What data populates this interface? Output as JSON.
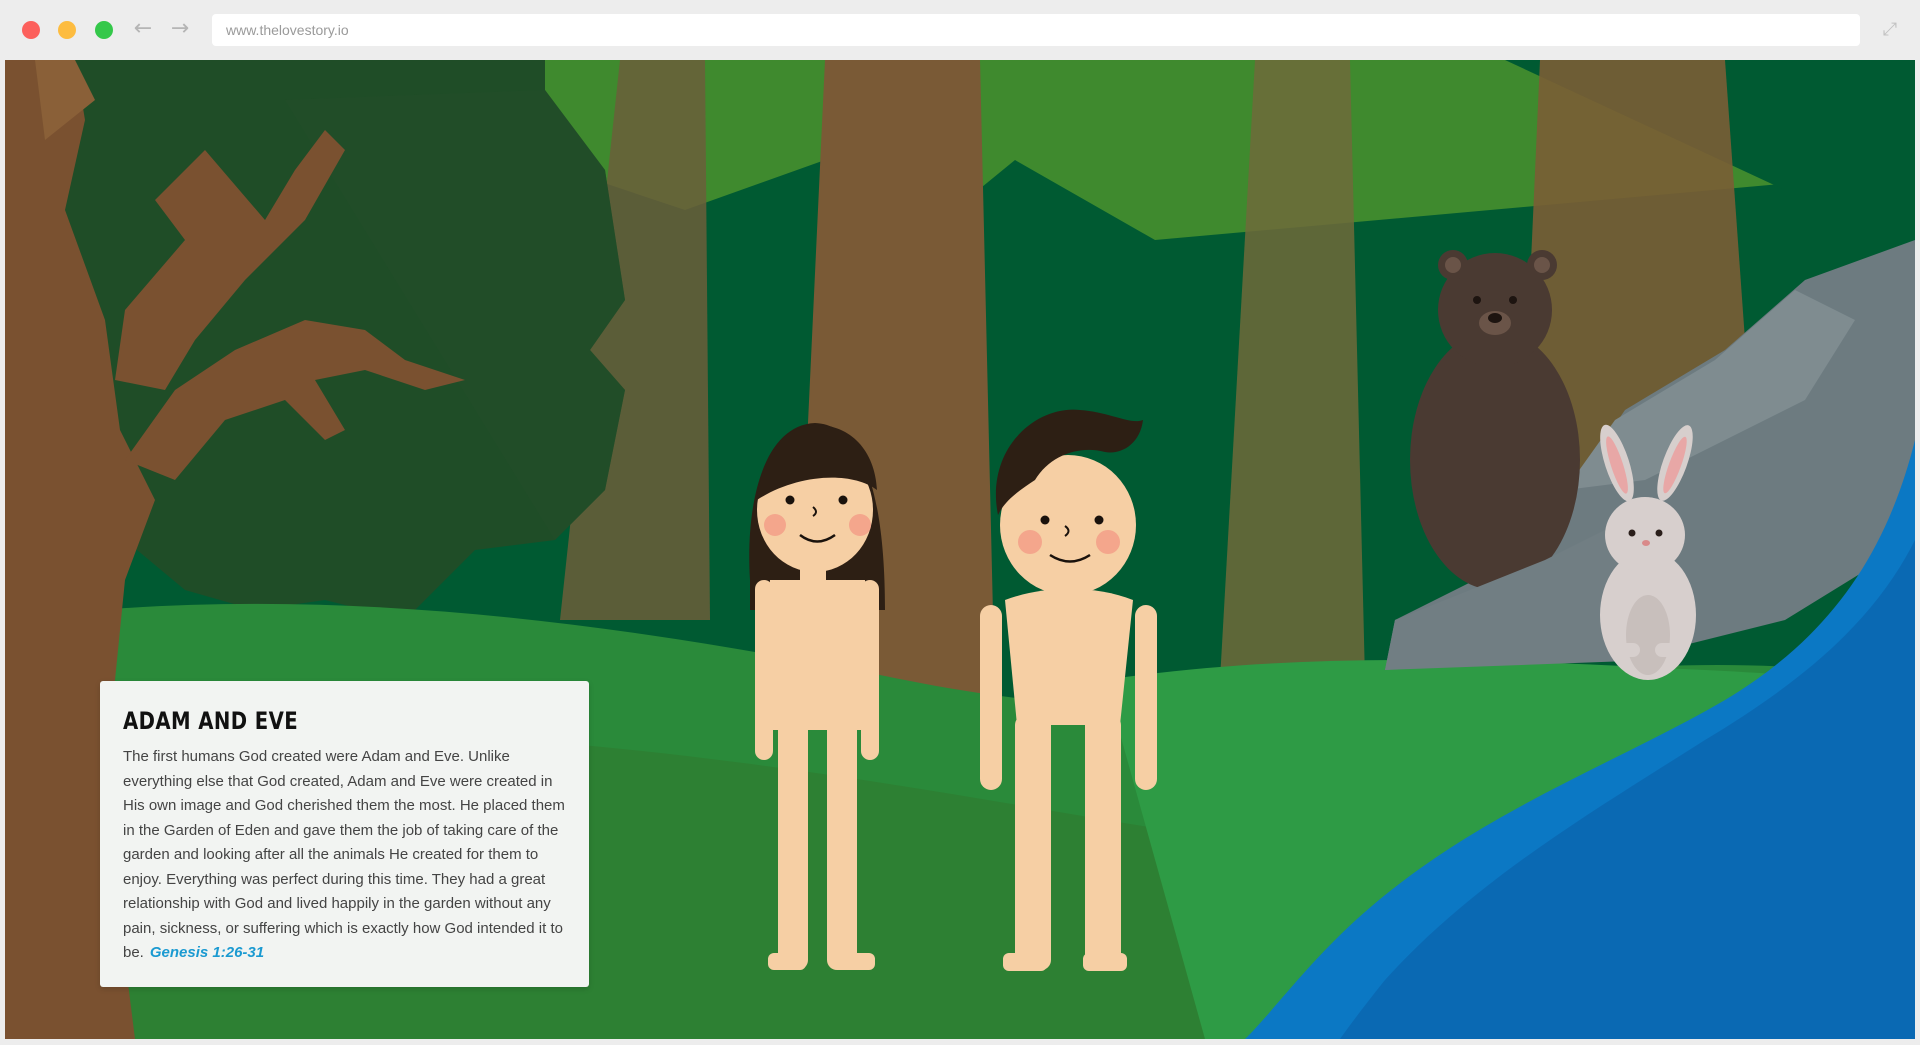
{
  "browser": {
    "url": "www.thelovestory.io"
  },
  "card": {
    "title": "ADAM AND EVE",
    "body": "The first humans God created were Adam and Eve. Unlike everything else that God created, Adam and Eve were created in His own image and God cherished them the most. He placed them in the Garden of Eden and gave them the job of taking care of the garden and looking after all the animals He created for them to enjoy. Everything was perfect during this time. They had a great relationship with God and lived happily in the garden without any pain, sickness, or suffering which is exactly how God intended it to be.",
    "reference": "Genesis 1:26-31"
  },
  "colors": {
    "forest_dark": "#005a32",
    "grass": "#2e8b3e",
    "river": "#0a74c2",
    "skin": "#f6cfa4",
    "hair": "#2d1f14",
    "link": "#1b9ad1"
  }
}
